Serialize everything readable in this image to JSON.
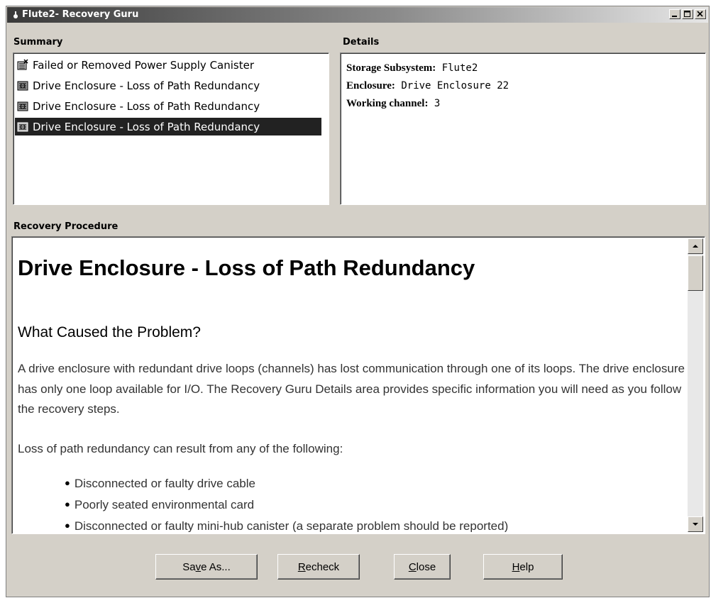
{
  "window": {
    "title": "Flute2- Recovery Guru",
    "controls": [
      "minimize-icon",
      "maximize-icon",
      "close-icon"
    ]
  },
  "summary": {
    "label": "Summary",
    "items": [
      {
        "label": "Failed or Removed Power Supply Canister",
        "icon": "power-supply-icon",
        "selected": false
      },
      {
        "label": "Drive Enclosure - Loss of Path Redundancy",
        "icon": "drive-enclosure-icon",
        "selected": false
      },
      {
        "label": "Drive Enclosure - Loss of Path Redundancy",
        "icon": "drive-enclosure-icon",
        "selected": false
      },
      {
        "label": "Drive Enclosure - Loss of Path Redundancy",
        "icon": "drive-enclosure-icon",
        "selected": true
      }
    ]
  },
  "details": {
    "label": "Details",
    "lines": [
      {
        "key": "Storage Subsystem:",
        "value": "Flute2"
      },
      {
        "key": "Enclosure:",
        "value": "Drive Enclosure 22"
      },
      {
        "key": "Working channel:",
        "value": "3"
      }
    ]
  },
  "procedure": {
    "label": "Recovery Procedure",
    "heading": "Drive Enclosure - Loss of Path Redundancy",
    "subheading": "What Caused the Problem?",
    "paragraph1": "A drive enclosure with redundant drive loops (channels) has lost communication through one of its loops. The drive enclosure has only one loop available for I/O. The Recovery Guru Details area provides specific information you will need as you follow the recovery steps.",
    "paragraph2": "Loss of path redundancy can result from any of the following:",
    "bullets": [
      "Disconnected or faulty drive cable",
      "Poorly seated environmental card",
      "Disconnected or faulty mini-hub canister (a separate problem should be reported)"
    ]
  },
  "buttons": {
    "save_as": {
      "pre": "Sa",
      "mnemonic": "v",
      "post": "e As..."
    },
    "recheck": {
      "pre": "",
      "mnemonic": "R",
      "post": "echeck"
    },
    "close": {
      "pre": "",
      "mnemonic": "C",
      "post": "lose"
    },
    "help": {
      "pre": "",
      "mnemonic": "H",
      "post": "elp"
    }
  }
}
